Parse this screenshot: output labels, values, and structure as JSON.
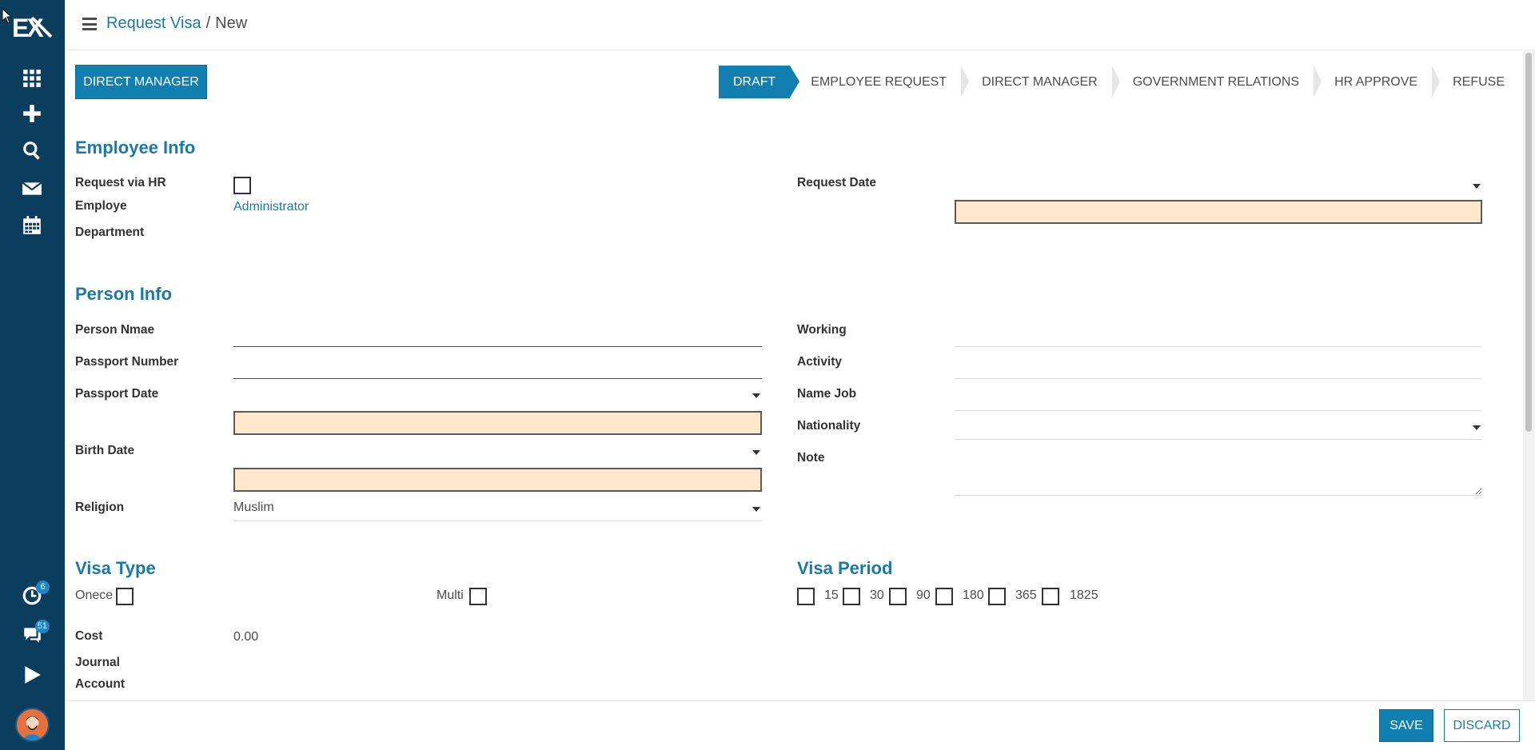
{
  "sidebar": {
    "logo_text": "EX",
    "icons": [
      "apps-icon",
      "plus-icon",
      "search-icon",
      "mail-icon",
      "calendar-icon",
      "activity-icon",
      "chat-icon",
      "play-icon"
    ],
    "activity_badge": "6",
    "chat_badge": "51"
  },
  "breadcrumb": {
    "parent": "Request Visa",
    "separator": "/",
    "current": "New"
  },
  "header_button": "DIRECT MANAGER",
  "stages": [
    "DRAFT",
    "EMPLOYEE REQUEST",
    "DIRECT MANAGER",
    "GOVERNMENT RELATIONS",
    "HR APPROVE",
    "REFUSE"
  ],
  "active_stage": "DRAFT",
  "employee_info": {
    "title": "Employee Info",
    "request_via_hr_label": "Request via HR",
    "employee_label": "Employe",
    "employee_value": "Administrator",
    "department_label": "Department",
    "request_date_label": "Request Date"
  },
  "person_info": {
    "title": "Person Info",
    "person_name_label": "Person Nmae",
    "passport_number_label": "Passport Number",
    "passport_date_label": "Passport Date",
    "birth_date_label": "Birth Date",
    "religion_label": "Religion",
    "religion_value": "Muslim",
    "working_label": "Working",
    "activity_label": "Activity",
    "name_job_label": "Name Job",
    "nationality_label": "Nationality",
    "note_label": "Note"
  },
  "visa_type": {
    "title": "Visa Type",
    "once_label": "Onece",
    "multi_label": "Multi",
    "cost_label": "Cost",
    "cost_value": "0.00",
    "journal_label": "Journal",
    "account_label": "Account"
  },
  "visa_period": {
    "title": "Visa Period",
    "options": [
      "15",
      "30",
      "90",
      "180",
      "365",
      "1825"
    ]
  },
  "footer": {
    "save_label": "SAVE",
    "discard_label": "DISCARD"
  },
  "colors": {
    "sidebar": "#0b3d5c",
    "accent": "#117fb0",
    "link": "#1a79a7",
    "required_bg": "#ffe8cc"
  }
}
